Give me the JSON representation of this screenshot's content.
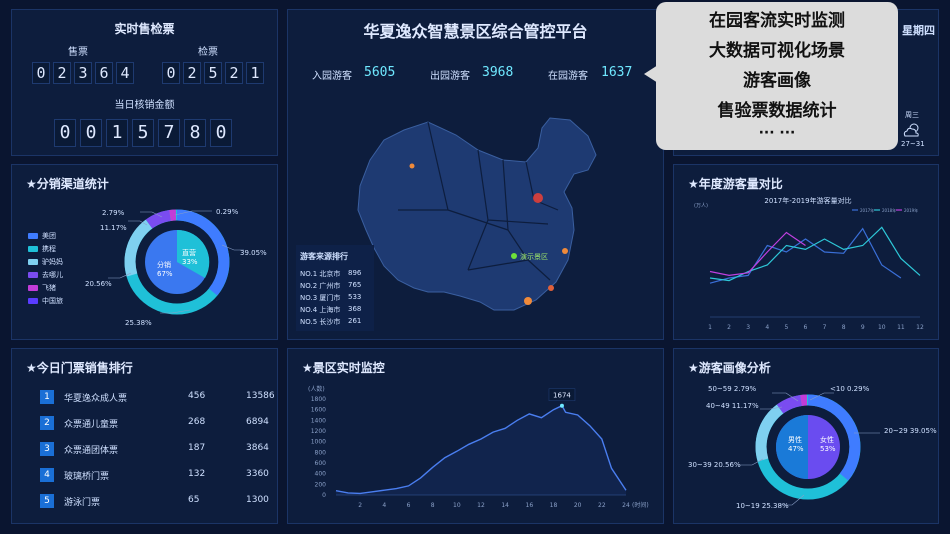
{
  "ticket": {
    "title": "实时售检票",
    "sale_label": "售票",
    "sale_digits": [
      "0",
      "2",
      "3",
      "6",
      "4"
    ],
    "check_label": "检票",
    "check_digits": [
      "0",
      "2",
      "5",
      "2",
      "1"
    ],
    "amount_label": "当日核销金额",
    "amount_digits": [
      "0",
      "0",
      "1",
      "5",
      "7",
      "8",
      "0"
    ]
  },
  "header": {
    "title": "华夏逸众智慧景区综合管控平台",
    "in_label": "入园游客",
    "in_value": "5605",
    "out_label": "出园游客",
    "out_value": "3968",
    "park_label": "在园游客",
    "park_value": "1637",
    "weekday_fragment": "星期四"
  },
  "weather": {
    "day": "周三",
    "temp": "27~31",
    "icon": "cloud-sun-icon"
  },
  "popup": {
    "lines": [
      "在园客流实时监测",
      "大数据可视化场景",
      "游客画像",
      "售验票数据统计"
    ],
    "more": "··· ···"
  },
  "channel": {
    "title": "★分销渠道统计",
    "legend": [
      {
        "name": "美团",
        "color": "#3f7cff"
      },
      {
        "name": "携程",
        "color": "#1fc0d8"
      },
      {
        "name": "驴妈妈",
        "color": "#7fd0f0"
      },
      {
        "name": "去哪儿",
        "color": "#7a4cf0"
      },
      {
        "name": "飞猪",
        "color": "#c23cd8"
      },
      {
        "name": "中国旅",
        "color": "#5a3cff"
      }
    ],
    "inner_a_label": "直营",
    "inner_a_pct": "33%",
    "inner_b_label": "分销",
    "inner_b_pct": "67%",
    "outer_labels": [
      "39.05%",
      "25.38%",
      "20.56%",
      "11.17%",
      "2.79%",
      "0.29%"
    ]
  },
  "map": {
    "source_title": "游客来源排行",
    "sources": [
      {
        "rank": "NO.1",
        "city": "北京市",
        "n": "896"
      },
      {
        "rank": "NO.2",
        "city": "广州市",
        "n": "765"
      },
      {
        "rank": "NO.3",
        "city": "厦门市",
        "n": "533"
      },
      {
        "rank": "NO.4",
        "city": "上海市",
        "n": "368"
      },
      {
        "rank": "NO.5",
        "city": "长沙市",
        "n": "261"
      }
    ],
    "demo_label": "演示景区"
  },
  "annual": {
    "title": "★年度游客量对比"
  },
  "ranking": {
    "title": "★今日门票销售排行",
    "rows": [
      {
        "no": "1",
        "name": "华夏逸众成人票",
        "qty": "456",
        "amount": "13586"
      },
      {
        "no": "2",
        "name": "众票通儿童票",
        "qty": "268",
        "amount": "6894"
      },
      {
        "no": "3",
        "name": "众票通团体票",
        "qty": "187",
        "amount": "3864"
      },
      {
        "no": "4",
        "name": "玻璃桥门票",
        "qty": "132",
        "amount": "3360"
      },
      {
        "no": "5",
        "name": "游泳门票",
        "qty": "65",
        "amount": "1300"
      }
    ]
  },
  "monitor": {
    "title": "★景区实时监控"
  },
  "portrait": {
    "title": "★游客画像分析",
    "male_label": "男性",
    "male_pct": "47%",
    "female_label": "女性",
    "female_pct": "53%",
    "age_labels": [
      "50~59 2.79%",
      "<10 0.29%",
      "40~49 11.17%",
      "20~29 39.05%",
      "30~39 20.56%",
      "10~19 25.38%"
    ]
  },
  "chart_data": [
    {
      "type": "line",
      "title": "2017年-2019年游客量对比",
      "ylabel": "(万人)",
      "x": [
        1,
        2,
        3,
        4,
        5,
        6,
        7,
        8,
        9,
        10,
        11,
        12
      ],
      "ylim": [
        0,
        8
      ],
      "series": [
        {
          "name": "2017年",
          "color": "#3a6fd8",
          "values": [
            2.6,
            3.0,
            3.2,
            5.5,
            5.0,
            6.0,
            5.0,
            4.9,
            6.8,
            4.0,
            3.0,
            null
          ]
        },
        {
          "name": "2018年",
          "color": "#2ec8d8",
          "values": [
            3.0,
            2.8,
            3.5,
            4.0,
            5.5,
            5.2,
            6.0,
            5.2,
            5.5,
            6.9,
            4.5,
            3.2
          ]
        },
        {
          "name": "2019年",
          "color": "#c040e0",
          "values": [
            3.5,
            3.2,
            3.4,
            5.0,
            6.5,
            5.5,
            null,
            null,
            null,
            null,
            null,
            null
          ]
        }
      ]
    },
    {
      "type": "area",
      "ylabel": "(人数)",
      "xlabel": "(时间)",
      "ylim": [
        0,
        1800
      ],
      "yticks": [
        0,
        200,
        400,
        600,
        800,
        1000,
        1200,
        1400,
        1600,
        1800
      ],
      "xticks": [
        2,
        4,
        6,
        8,
        10,
        12,
        14,
        16,
        18,
        20,
        22,
        24
      ],
      "x": [
        0,
        1,
        2,
        3,
        4,
        5,
        6,
        7,
        8,
        9,
        10,
        11,
        12,
        13,
        14,
        15,
        16,
        17,
        18,
        18.7,
        19,
        20,
        21,
        22,
        22.8,
        24
      ],
      "values": [
        80,
        40,
        30,
        60,
        90,
        120,
        170,
        320,
        520,
        700,
        820,
        950,
        1050,
        1180,
        1250,
        1400,
        1520,
        1450,
        1600,
        1674,
        1550,
        1500,
        1300,
        1050,
        500,
        90
      ],
      "peak_label": "1674"
    }
  ]
}
